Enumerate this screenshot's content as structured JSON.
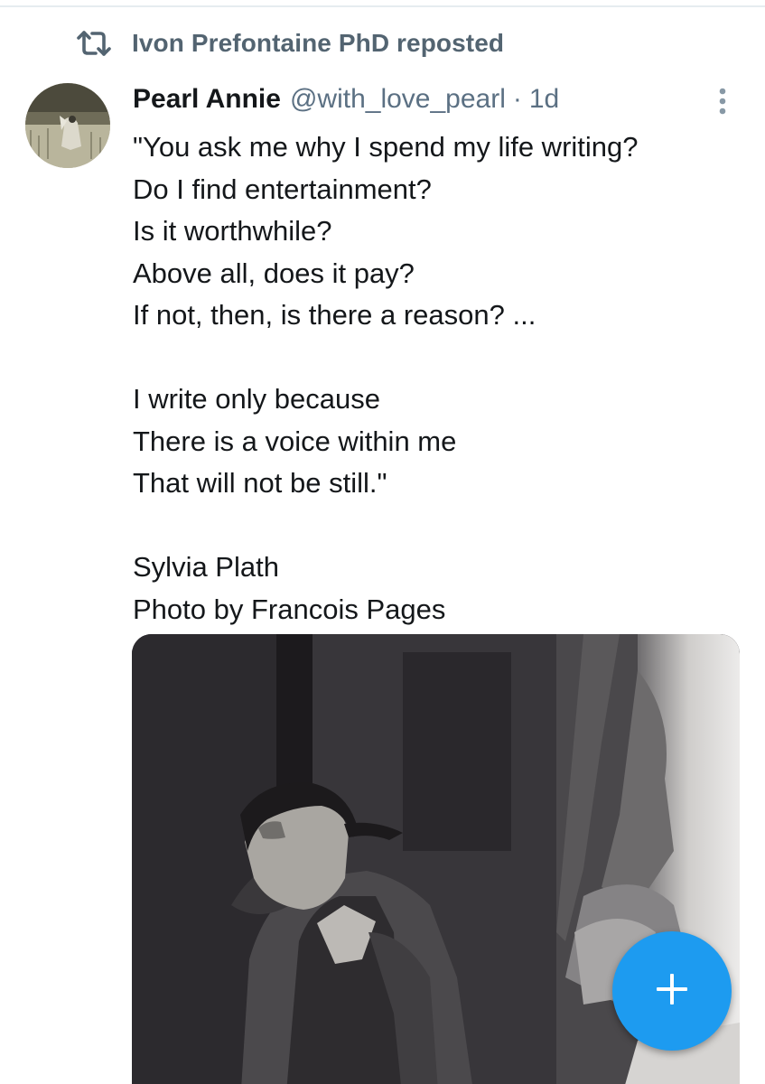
{
  "repost": {
    "label": "Ivon Prefontaine PhD reposted",
    "icon": "repost-icon"
  },
  "tweet": {
    "author_name": "Pearl Annie",
    "handle": "@with_love_pearl",
    "separator": "·",
    "time": "1d",
    "more_icon": "more-vertical-icon",
    "lines": [
      "\"You ask me why I spend my life writing?",
      "Do I find entertainment?",
      "Is it worthwhile?",
      "Above all, does it pay?",
      "If not, then, is there a reason? ...",
      "",
      "I write only because",
      "There is a voice within me",
      "That will not be still.\"",
      "",
      "Sylvia Plath",
      "Photo by Francois Pages"
    ]
  },
  "fab": {
    "icon": "plus-icon",
    "color": "#1d9bf0"
  },
  "colors": {
    "secondary_text": "#5b7083",
    "primary_text": "#14171a",
    "accent": "#1d9bf0"
  }
}
